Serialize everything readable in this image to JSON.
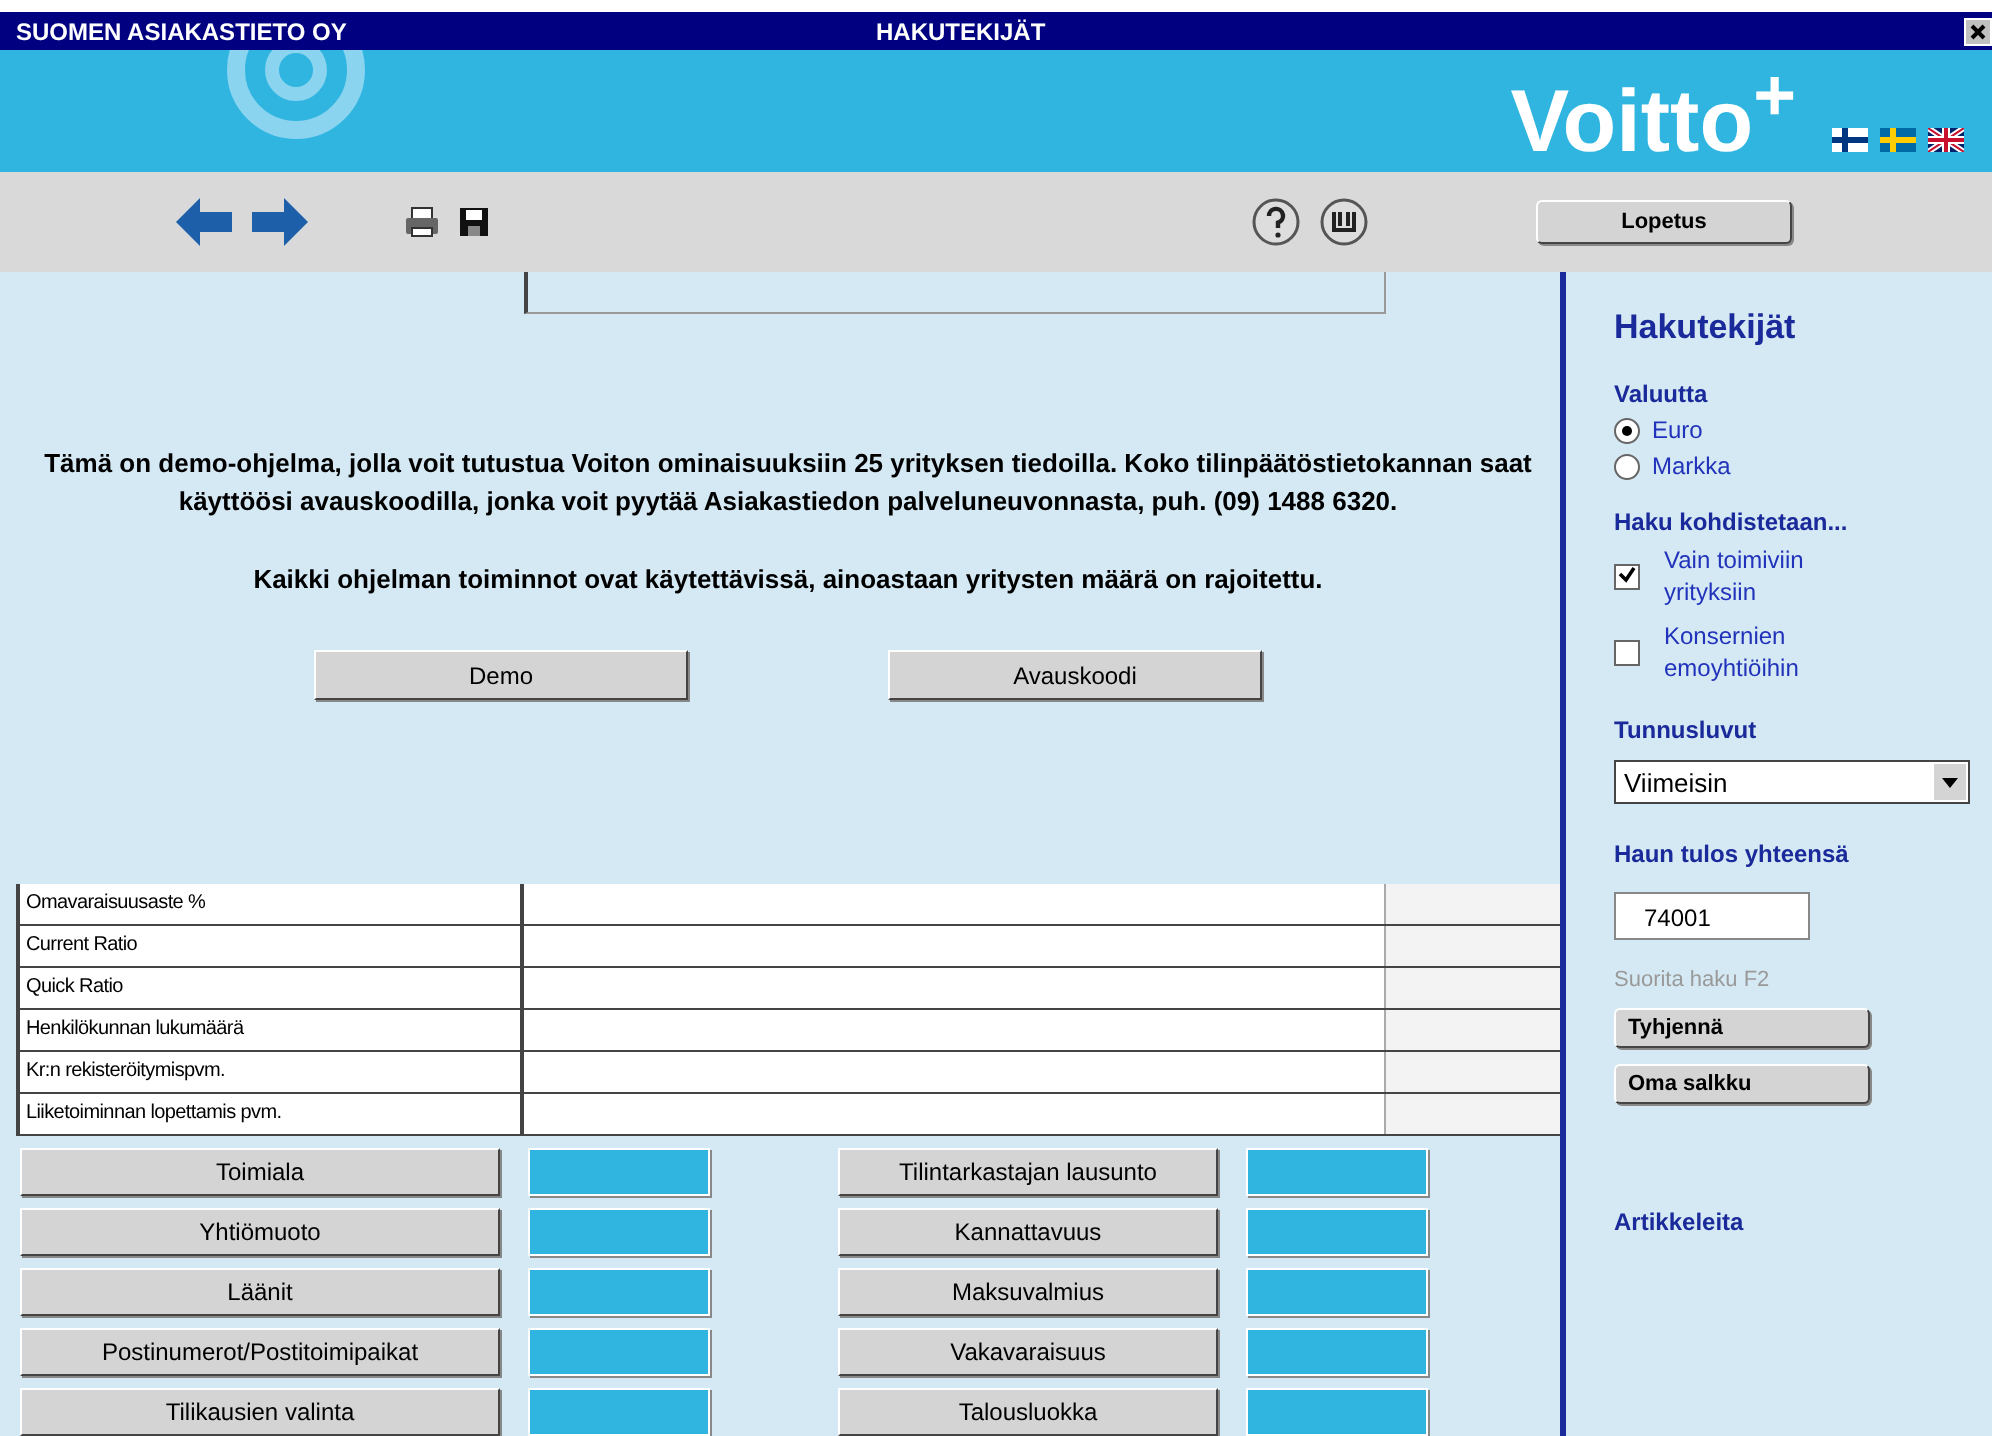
{
  "window": {
    "title_left": "SUOMEN ASIAKASTIETO OY",
    "title": "HAKUTEKIJÄT"
  },
  "banner": {
    "logo": "Voitto$^{+}$"
  },
  "toolbar": {
    "exit_button": "Lopetus"
  },
  "intro": {
    "paragraphs": [
      "Tämä on demo-ohjelma, jolla voit tutustua Voiton ominaisuuksiin 25 yrityksen tiedoilla. Koko tilinpäätöstietokannan saat käyttöösi avauskoodilla, jonka voit pyytää Asiakastiedon palveluneuvonnasta, puh. (09) 1488 6320.",
      "Kaikki ohjelman toiminnot ovat käytettävissä, ainoastaan yritysten määrä on rajoitettu."
    ],
    "buttons": [
      "Demo",
      "Avauskoodi"
    ]
  },
  "table": {
    "rows": [
      {
        "label": "Omavaraisuusaste %"
      },
      {
        "label": "Current Ratio"
      },
      {
        "label": "Quick Ratio"
      },
      {
        "label": "Henkilökunnan lukumäärä"
      },
      {
        "label": "Kr:n rekisteröitymispvm."
      },
      {
        "label": "Liiketoiminnan lopettamis pvm."
      }
    ]
  },
  "criteria": [
    {
      "label": "Toimiala"
    },
    {
      "label": "Tilintarkastajan lausunto"
    },
    {
      "label": "Yhtiömuoto"
    },
    {
      "label": "Kannattavuus"
    },
    {
      "label": "Läänit"
    },
    {
      "label": "Maksuvalmius"
    },
    {
      "label": "Postinumerot/Postitoimipaikat"
    },
    {
      "label": "Vakavaraisuus"
    },
    {
      "label": "Tilikausien valinta"
    },
    {
      "label": "Talousluokka"
    }
  ],
  "sidebar": {
    "title": "Hakutekijät",
    "currency": {
      "heading": "Valuutta",
      "options": [
        {
          "label": "Euro",
          "selected": true
        },
        {
          "label": "Markka",
          "selected": false
        }
      ]
    },
    "target": {
      "heading": "Haku kohdistetaan...",
      "options": [
        {
          "label": "Vain toimiviin yrityksiin",
          "checked": true
        },
        {
          "label": "Konsernien emoyhtiöihin",
          "checked": false
        }
      ]
    },
    "ratios": {
      "heading": "Tunnusluvut",
      "value": "Viimeisin"
    },
    "result": {
      "heading": "Haun tulos yhteensä",
      "value": "74001",
      "hint": "Suorita haku F2"
    },
    "buttons": [
      "Tyhjennä",
      "Oma salkku"
    ],
    "articles": "Artikkeleita"
  }
}
